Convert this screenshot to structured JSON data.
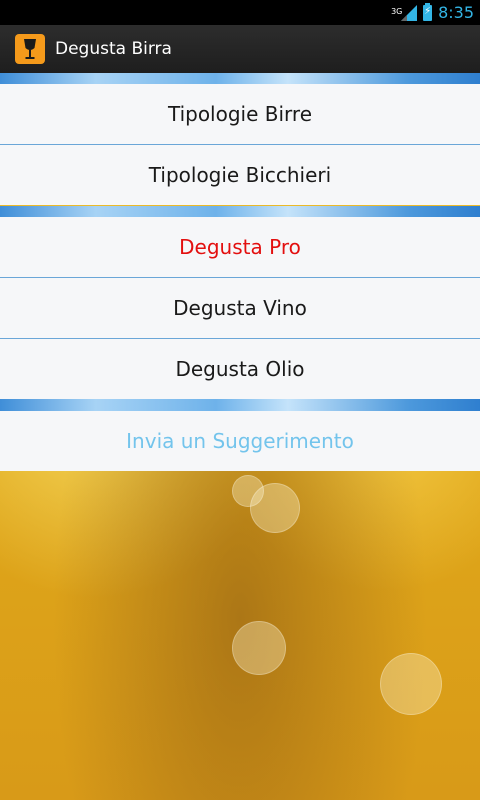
{
  "status_bar": {
    "network": "3G",
    "time": "8:35"
  },
  "app": {
    "title": "Degusta Birra",
    "icon": "wine-glass-icon"
  },
  "menu": {
    "items": [
      {
        "label": "Tipologie Birre"
      },
      {
        "label": "Tipologie Bicchieri"
      },
      {
        "label": "Degusta Pro"
      },
      {
        "label": "Degusta Vino"
      },
      {
        "label": "Degusta Olio"
      },
      {
        "label": "Invia un Suggerimento"
      }
    ]
  },
  "colors": {
    "accent_blue": "#33b5e5",
    "pro_red": "#e30f0f",
    "suggestion_light_blue": "#73c4ec",
    "icon_orange": "#f59a1b"
  }
}
